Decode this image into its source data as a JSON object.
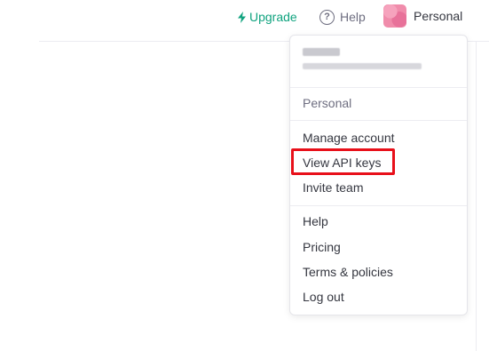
{
  "nav": {
    "upgrade_label": "Upgrade",
    "upgrade_icon": "lightning-icon",
    "help_label": "Help",
    "help_icon": "question-circle-icon",
    "personal_label": "Personal",
    "accent_color": "#10a37f"
  },
  "menu": {
    "org_label": "Personal",
    "items_account": [
      "Manage account",
      "View API keys",
      "Invite team"
    ],
    "items_support": [
      "Help",
      "Pricing",
      "Terms & policies",
      "Log out"
    ],
    "highlight_color": "#e8101a"
  }
}
